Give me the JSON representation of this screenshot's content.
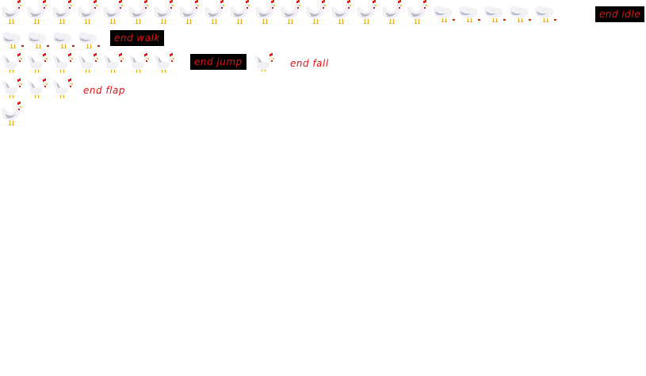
{
  "sprite_sheet": {
    "rows": [
      {
        "id": "idle",
        "frame_count": 22,
        "end_label": "end idle",
        "label_boxed": true
      },
      {
        "id": "walk",
        "frame_count": 4,
        "end_label": "end walk",
        "label_boxed": true
      },
      {
        "id": "jump",
        "frame_count": 7,
        "end_label": "end jump",
        "label_boxed": true
      },
      {
        "id": "fall",
        "frame_count": 1,
        "end_label": "end fall",
        "label_boxed": false
      },
      {
        "id": "flap",
        "frame_count": 3,
        "end_label": "end flap",
        "label_boxed": false
      },
      {
        "id": "misc",
        "frame_count": 1,
        "end_label": "",
        "label_boxed": false
      }
    ]
  },
  "labels": {
    "idle": "end idle",
    "walk": "end walk",
    "jump": "end jump",
    "fall": "end fall",
    "flap": "end flap"
  },
  "colors": {
    "body": "#f2f2f6",
    "shade": "#b9bccb",
    "comb": "#e41b1b",
    "beak": "#f3c23a",
    "legs": "#e2a91c",
    "label_text": "#e01414",
    "label_box": "#000000"
  }
}
